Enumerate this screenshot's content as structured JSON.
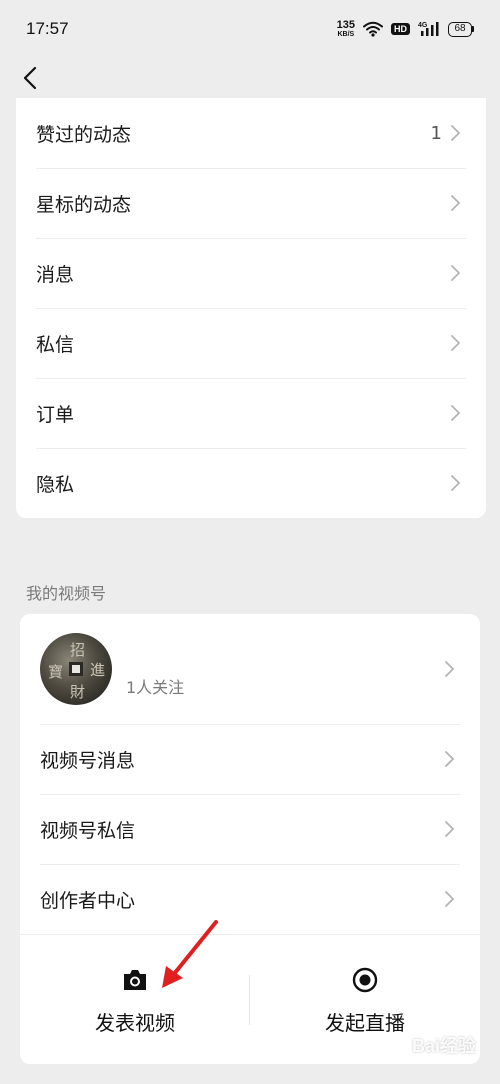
{
  "status_bar": {
    "time": "17:57",
    "net_speed": "135",
    "net_unit": "KB/S",
    "hd": "HD",
    "network": "4G",
    "battery": "68"
  },
  "menu": {
    "items": [
      {
        "label": "赞过的动态",
        "count": "1"
      },
      {
        "label": "星标的动态",
        "count": ""
      },
      {
        "label": "消息",
        "count": ""
      },
      {
        "label": "私信",
        "count": ""
      },
      {
        "label": "订单",
        "count": ""
      },
      {
        "label": "隐私",
        "count": ""
      }
    ]
  },
  "channels": {
    "section_title": "我的视频号",
    "profile": {
      "followers": "1人关注"
    },
    "items": [
      {
        "label": "视频号消息"
      },
      {
        "label": "视频号私信"
      },
      {
        "label": "创作者中心"
      }
    ],
    "actions": {
      "post_video": "发表视频",
      "start_live": "发起直播"
    }
  },
  "icons": {
    "back": "chevron-left-icon",
    "chevron": "chevron-right-icon",
    "camera": "camera-icon",
    "live": "record-icon",
    "arrow": "red-arrow-annotation"
  },
  "colors": {
    "background": "#ededed",
    "card": "#ffffff",
    "annotation_arrow": "#e02020"
  },
  "watermark": "Bai经验"
}
